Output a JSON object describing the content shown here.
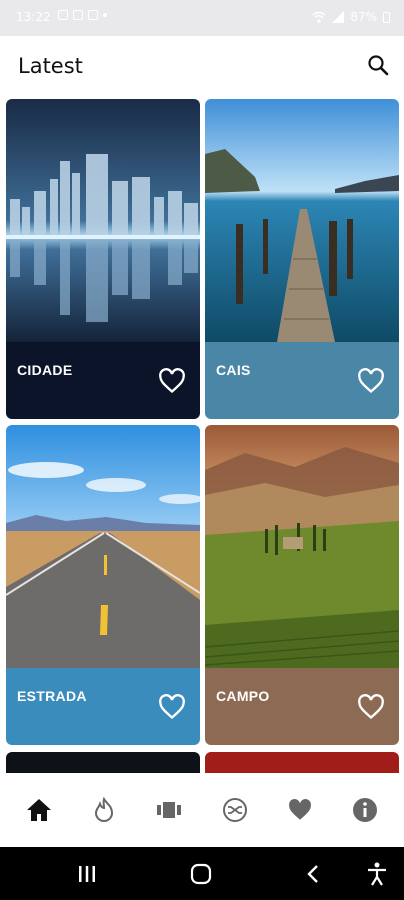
{
  "status_bar": {
    "time": "13:22",
    "battery": "87%"
  },
  "app_bar": {
    "title": "Latest",
    "search_icon": "search-icon"
  },
  "cards": [
    {
      "label": "CIDADE",
      "bar_color": "#0b1428",
      "icon": "heart-outline-icon"
    },
    {
      "label": "CAIS",
      "bar_color": "#4a86a6",
      "icon": "heart-outline-icon"
    },
    {
      "label": "ESTRADA",
      "bar_color": "#3a8cbc",
      "icon": "heart-outline-icon"
    },
    {
      "label": "CAMPO",
      "bar_color": "#8d6a53",
      "icon": "heart-outline-icon"
    }
  ],
  "bottom_nav": {
    "items": [
      "home-icon",
      "fire-icon",
      "categories-icon",
      "shuffle-icon",
      "heart-icon",
      "info-icon"
    ],
    "active": "home-icon"
  },
  "system_nav": [
    "recents-icon",
    "home-circle-icon",
    "back-icon",
    "accessibility-icon"
  ]
}
